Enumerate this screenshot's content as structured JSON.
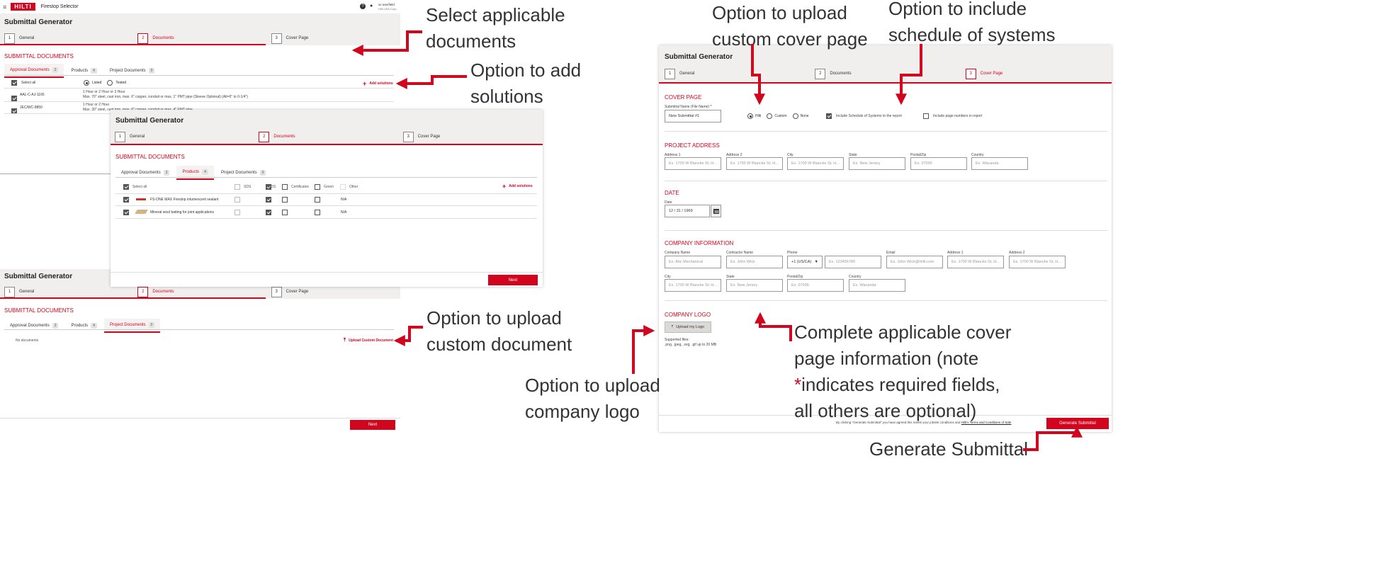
{
  "app": {
    "brand": "HILTI",
    "title": "Firestop Selector",
    "user_name": "xx userfield",
    "user_company": "Hilti USA Corp."
  },
  "generator": {
    "title": "Submittal Generator",
    "steps": [
      {
        "num": "1",
        "label": "General"
      },
      {
        "num": "2",
        "label": "Documents"
      },
      {
        "num": "3",
        "label": "Cover Page"
      }
    ],
    "next_label": "Next"
  },
  "documents": {
    "section_title": "SUBMITTAL DOCUMENTS",
    "tabs": [
      {
        "label": "Approval Documents",
        "count": "2"
      },
      {
        "label": "Products",
        "count": "4"
      },
      {
        "label": "Project Documents",
        "count": "0"
      }
    ],
    "select_all": "Select all",
    "listed_label": "Listed",
    "tested_label": "Tested",
    "add_solutions": "Add solutions",
    "approval_rows": [
      {
        "code": "AAL-C-AJ-1165",
        "line1": "1 Hour or 2 Hour or 3 Hour",
        "line2": "Max. 70\" steel, cast iron, max. 6\" copper, conduit or max. 1\" PMT pipe (Sleeve Optional) (Alt=6\" to 0-1/4\")"
      },
      {
        "code": "JEC/WC-8850",
        "line1": "1 Hour or 2 Hour",
        "line2": "Max. 30\" steel, cast iron, max. 6\" copper, conduit or max. 4\" EMT pipe"
      }
    ],
    "product_cols": [
      "SDS",
      "PDS",
      "Certificates",
      "Green",
      "Other"
    ],
    "product_rows": [
      {
        "name": "FS-ONE MAX Firestop intumescent sealant",
        "other": "N/A"
      },
      {
        "name": "Mineral wool batting for joint applications",
        "other": "N/A"
      }
    ],
    "no_documents": "No documents",
    "upload_custom": "Upload Custom Document"
  },
  "cover": {
    "section_title": "COVER PAGE",
    "name_label": "Submittal Name (File Name) *",
    "name_value": "New Submittal #1",
    "logo_options": [
      "Hilti",
      "Custom",
      "None"
    ],
    "include_schedule": "Include Schedule of Systems to the report",
    "include_page_numbers": "Include page numbers in report",
    "project_address_title": "PROJECT ADDRESS",
    "address_labels": [
      "Address 1",
      "Address 2",
      "City",
      "State",
      "Postal/Zip",
      "Country"
    ],
    "address_placeholders": [
      "Ex. 1700 W Blancke St, H...",
      "Ex. 1700 W Blancke St, H...",
      "Ex. 1700 W Blancke St, H...",
      "Ex. New Jersey",
      "Ex. 07036",
      "Ex. Wacanda"
    ],
    "date_title": "DATE",
    "date_label": "Date",
    "date_value": "12 / 31 / 1969",
    "company_title": "COMPANY INFORMATION",
    "company_labels": [
      "Company Name",
      "Contractor Name",
      "Phone",
      "Email",
      "Address 1",
      "Address 2"
    ],
    "company_placeholders": [
      "Ex. Abc Mechanical",
      "Ex. John Wick",
      "Ex. 123456789",
      "Ex. John.Wick@Hilti.com",
      "Ex. 1700 W Blancke St, H...",
      "Ex. 1700 W Blancke St, H..."
    ],
    "phone_code": "+1 (US/CA)",
    "company_labels2": [
      "City",
      "State",
      "Postal/Zip",
      "Country"
    ],
    "company_placeholders2": [
      "Ex. 1700 W Blancke St, H...",
      "Ex. New Jersey",
      "Ex. 07036",
      "Ex. Wacanda"
    ],
    "logo_title": "COMPANY LOGO",
    "upload_logo": "Upload my Logo",
    "supported_label": "Supported files:",
    "supported_files": ".png, .jpeg, .svg, .gif up to 20 MB",
    "footer_text": "By clicking \"Generate Submittal\" you have agreed this meets your jobsite conditions and",
    "footer_link": "Hilti's Terms and Conditions of Sale",
    "generate_label": "Generate Submittal"
  },
  "annotations": {
    "select_docs": [
      "Select applicable",
      "documents"
    ],
    "add_solutions": [
      "Option to add",
      "solutions"
    ],
    "upload_doc": [
      "Option to upload",
      "custom document"
    ],
    "upload_logo": [
      "Option to upload",
      "company logo"
    ],
    "upload_cover": [
      "Option to upload",
      "custom cover page"
    ],
    "schedule": [
      "Option to include",
      "schedule of systems"
    ],
    "complete_info_l1": "Complete applicable cover",
    "complete_info_l2": "page information (note",
    "complete_info_star": "*",
    "complete_info_l3": "indicates required fields,",
    "complete_info_l4": "all others are optional)",
    "generate": "Generate Submittal"
  },
  "colors": {
    "accent": "#d2051e",
    "panel_head": "#f1efed"
  }
}
